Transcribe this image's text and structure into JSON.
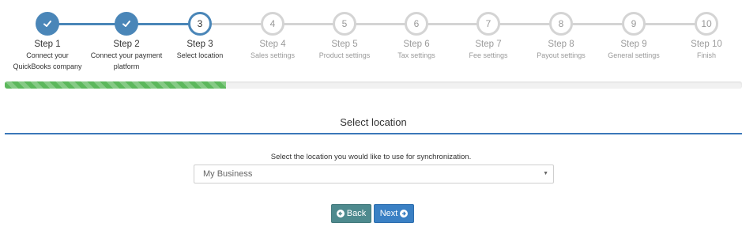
{
  "wizard": {
    "steps": [
      {
        "title": "Step 1",
        "desc": "Connect your QuickBooks company",
        "state": "done",
        "icon": "check-icon"
      },
      {
        "title": "Step 2",
        "desc": "Connect your payment platform",
        "state": "done",
        "icon": "check-icon"
      },
      {
        "title": "Step 3",
        "desc": "Select location",
        "state": "active",
        "number": "3"
      },
      {
        "title": "Step 4",
        "desc": "Sales settings",
        "state": "todo",
        "number": "4"
      },
      {
        "title": "Step 5",
        "desc": "Product settings",
        "state": "todo",
        "number": "5"
      },
      {
        "title": "Step 6",
        "desc": "Tax settings",
        "state": "todo",
        "number": "6"
      },
      {
        "title": "Step 7",
        "desc": "Fee settings",
        "state": "todo",
        "number": "7"
      },
      {
        "title": "Step 8",
        "desc": "Payout settings",
        "state": "todo",
        "number": "8"
      },
      {
        "title": "Step 9",
        "desc": "General settings",
        "state": "todo",
        "number": "9"
      },
      {
        "title": "Step 10",
        "desc": "Finish",
        "state": "todo",
        "number": "10"
      }
    ],
    "colors": {
      "done": "#4a86b8",
      "todo": "#d4d4d4"
    }
  },
  "progress": {
    "fraction": 0.3,
    "color": "#5cb85c"
  },
  "section": {
    "title": "Select location"
  },
  "location": {
    "instruction": "Select the location you would like to use for synchronization.",
    "selected": "My Business",
    "caret_icon": "caret-down-icon"
  },
  "buttons": {
    "back_label": "Back",
    "back_icon": "arrow-circle-left-icon",
    "next_label": "Next",
    "next_icon": "arrow-circle-right-icon"
  }
}
